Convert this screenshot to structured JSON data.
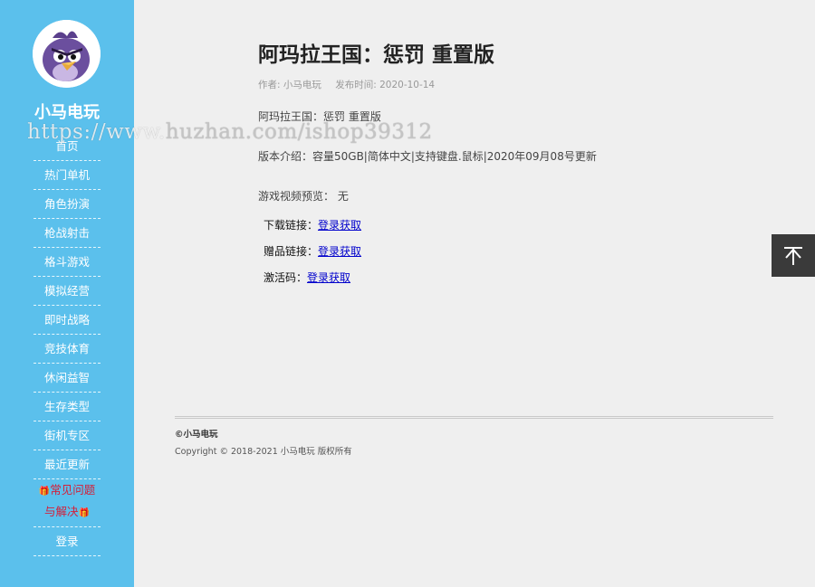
{
  "sidebar": {
    "site_name": "小马电玩",
    "avatar_icon": "angry-bird-avatar",
    "nav": [
      {
        "label": "首页"
      },
      {
        "label": "热门单机"
      },
      {
        "label": "角色扮演"
      },
      {
        "label": "枪战射击"
      },
      {
        "label": "格斗游戏"
      },
      {
        "label": "模拟经营"
      },
      {
        "label": "即时战略"
      },
      {
        "label": "竞技体育"
      },
      {
        "label": "休闲益智"
      },
      {
        "label": "生存类型"
      },
      {
        "label": "街机专区"
      },
      {
        "label": "最近更新"
      }
    ],
    "faq": {
      "label": "常见问题与解决",
      "icon": "gift-icon",
      "color": "#d3203a"
    },
    "login": "登录",
    "bg_color": "#5bc0ec"
  },
  "watermark": {
    "prefix": "https://www.",
    "suffix": "huzhan.com/ishop39312"
  },
  "article": {
    "title": "阿玛拉王国：惩罚 重置版",
    "author": "作者: 小马电玩",
    "publish_time": "发布时间: 2020-10-14",
    "line1": "阿玛拉王国：惩罚 重置版",
    "line2": "版本介绍：容量50GB|简体中文|支持键盘.鼠标|2020年09月08号更新",
    "line3": "游戏视频预览： 无",
    "download_label": "下载链接：",
    "download_link": "登录获取",
    "gift_label": "赠品链接：",
    "gift_link": "登录获取",
    "code_label": "激活码：",
    "code_link": "登录获取"
  },
  "footer": {
    "brand": "©小马电玩",
    "copyright": "Copyright © 2018-2021 小马电玩 版权所有"
  },
  "back_to_top": {
    "icon": "arrow-up-icon"
  }
}
